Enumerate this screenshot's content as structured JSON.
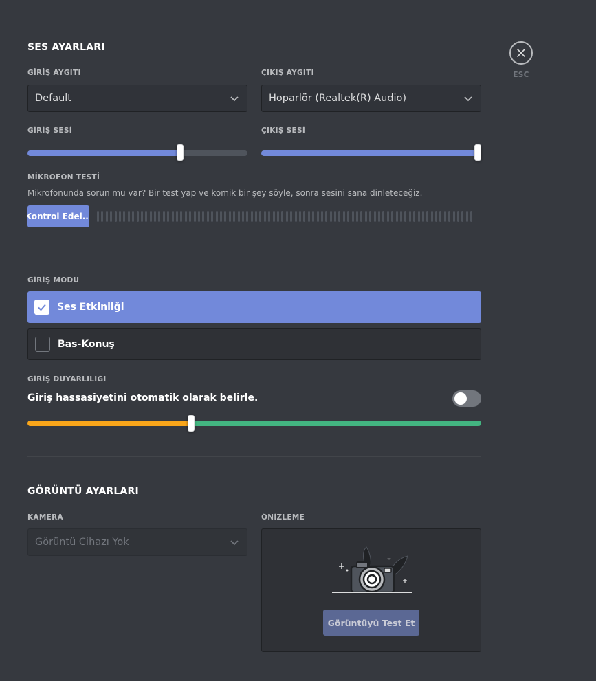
{
  "voice": {
    "title": "SES AYARLARI",
    "input_device_label": "GİRİŞ AYGITI",
    "input_device_value": "Default",
    "output_device_label": "ÇIKIŞ AYGITI",
    "output_device_value": "Hoparlör (Realtek(R) Audio)",
    "input_volume_label": "GİRİŞ SESİ",
    "input_volume_level": 0.7,
    "output_volume_label": "ÇIKIŞ SESİ",
    "output_volume_level": 1.0,
    "mic_test_label": "MİKROFON TESTİ",
    "mic_test_desc": "Mikrofonunda sorun mu var? Bir test yap ve komik bir şey söyle, sonra sesini sana dinleteceğiz.",
    "mic_test_button": "Kontrol Edel...",
    "input_mode_label": "GİRİŞ MODU",
    "mode_voice_activity": "Ses Etkinliği",
    "mode_push_to_talk": "Bas-Konuş",
    "sensitivity_label": "GİRİŞ DUYARLILIĞI",
    "sensitivity_auto_text": "Giriş hassasiyetini otomatik olarak belirle.",
    "sensitivity_level": 0.36
  },
  "video": {
    "title": "GÖRÜNTÜ AYARLARI",
    "camera_label": "KAMERA",
    "camera_value": "Görüntü Cihazı Yok",
    "preview_label": "ÖNİZLEME",
    "test_button": "Görüntüyü Test Et"
  },
  "close": {
    "esc_label": "ESC"
  },
  "colors": {
    "accent": "#7289da",
    "sensitivity_low": "#faa61a",
    "sensitivity_high": "#43b581"
  }
}
